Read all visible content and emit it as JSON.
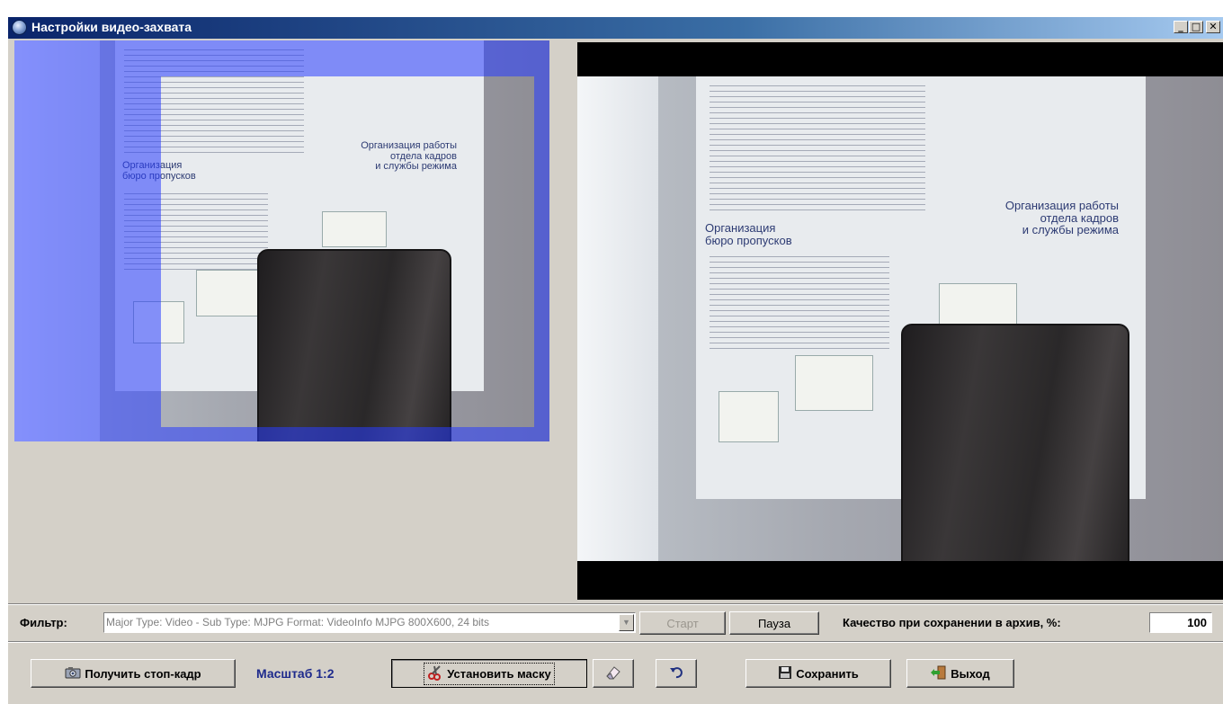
{
  "window": {
    "title": "Настройки видео-захвата",
    "caption_buttons": {
      "minimize": "_",
      "maximize": "□",
      "close": "✕"
    }
  },
  "video": {
    "left_preview": {
      "has_mask_overlay": true,
      "mask_color": "#2a3cff"
    },
    "right_preview": {
      "letterbox_color": "#000000"
    },
    "poster": {
      "left_heading": "Организация\nбюро пропусков",
      "right_heading": "Организация работы\nотдела кадров\nи службы режима"
    }
  },
  "filter_row": {
    "label": "Фильтр:",
    "combo_value": "Major Type: Video - Sub Type: MJPG Format: VideoInfo MJPG 800X600, 24 bits",
    "start_label": "Старт",
    "pause_label": "Пауза",
    "quality_label": "Качество при сохранении в архив, %:",
    "quality_value": "100"
  },
  "action_row": {
    "snapshot_label": "Получить стоп-кадр",
    "scale_label": "Масштаб 1:2",
    "set_mask_label": "Установить маску",
    "save_label": "Сохранить",
    "exit_label": "Выход"
  },
  "icons": {
    "window": "webcam-icon",
    "snapshot": "camera-icon",
    "set_mask": "scissors-icon",
    "eraser": "eraser-icon",
    "undo": "undo-icon",
    "save": "floppy-disk-icon",
    "exit": "exit-door-icon"
  }
}
